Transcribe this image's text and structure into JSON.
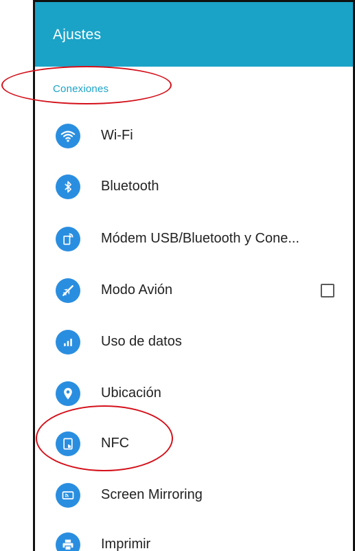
{
  "app_bar": {
    "title": "Ajustes"
  },
  "section": {
    "title": "Conexiones"
  },
  "items": [
    {
      "label": "Wi-Fi",
      "icon": "wifi-icon"
    },
    {
      "label": "Bluetooth",
      "icon": "bluetooth-icon"
    },
    {
      "label": "Módem USB/Bluetooth y Cone...",
      "icon": "tethering-icon"
    },
    {
      "label": "Modo Avión",
      "icon": "airplane-icon",
      "checked": false
    },
    {
      "label": "Uso de datos",
      "icon": "data-usage-icon"
    },
    {
      "label": "Ubicación",
      "icon": "location-icon"
    },
    {
      "label": "NFC",
      "icon": "nfc-icon"
    },
    {
      "label": "Screen Mirroring",
      "icon": "screen-mirroring-icon"
    },
    {
      "label": "Imprimir",
      "icon": "printer-icon"
    }
  ],
  "colors": {
    "app_bar": "#1aa3c7",
    "section_header": "#1aa3c7",
    "icon_bg": "#2a8ee0",
    "annotation": "#d4101a"
  }
}
